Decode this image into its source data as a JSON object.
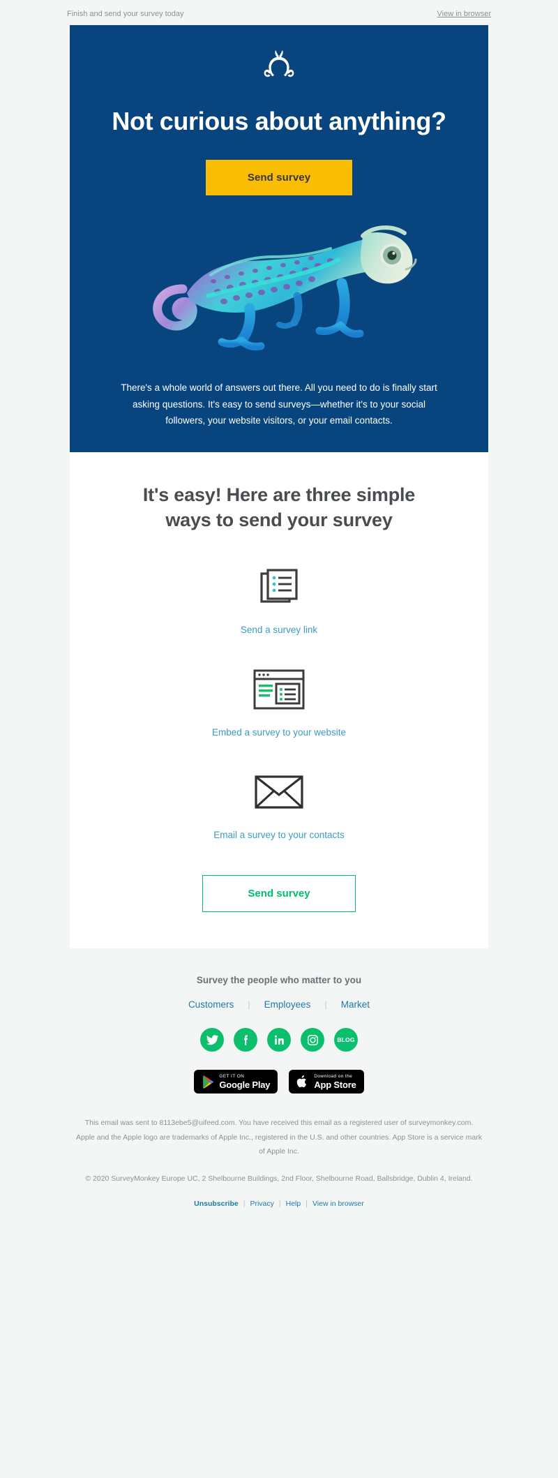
{
  "preheader": {
    "text": "Finish and send your survey today",
    "view_in_browser": "View in browser"
  },
  "hero": {
    "logo_icon": "surveymonkey-logo-icon",
    "title": "Not curious about anything?",
    "cta_label": "Send survey",
    "image_alt": "chameleon-illustration",
    "body": "There's a whole world of answers out there. All you need to do is finally start asking questions. It's easy to send surveys—whether it's to your social followers, your website visitors, or your email contacts.",
    "bg_color": "#08457e",
    "cta_bg_color": "#fbbc04",
    "cta_text_color": "#34373a"
  },
  "main": {
    "title": "It's easy! Here are three simple ways to send your survey",
    "features": [
      {
        "icon": "survey-link-icon",
        "label": "Send a survey link"
      },
      {
        "icon": "embed-website-icon",
        "label": "Embed a survey to your website"
      },
      {
        "icon": "email-envelope-icon",
        "label": "Email a survey to your contacts"
      }
    ],
    "cta_label": "Send survey",
    "cta_border_color": "#00bf6f",
    "link_color": "#3a9cc4"
  },
  "footer": {
    "heading": "Survey the people who matter to you",
    "links": [
      {
        "label": "Customers"
      },
      {
        "label": "Employees"
      },
      {
        "label": "Market"
      }
    ],
    "separator": "|",
    "social": [
      {
        "name": "twitter-icon",
        "label": ""
      },
      {
        "name": "facebook-icon",
        "label": ""
      },
      {
        "name": "linkedin-icon",
        "label": ""
      },
      {
        "name": "instagram-icon",
        "label": ""
      },
      {
        "name": "blog-icon",
        "label": "BLOG"
      }
    ],
    "social_color": "#0cbf6c",
    "stores": [
      {
        "name": "google-play-badge",
        "top": "GET IT ON",
        "bottom": "Google Play"
      },
      {
        "name": "app-store-badge",
        "top": "Download on the",
        "bottom": "App Store"
      }
    ],
    "legal_1": "This email was sent to 8113ebe5@uifeed.com. You have received this email as a registered user of surveymonkey.com.",
    "legal_2": "Apple and the Apple logo are trademarks of Apple Inc., registered in the U.S. and other countries. App Store is a service mark of Apple Inc.",
    "legal_3": "© 2020 SurveyMonkey Europe UC, 2 Shelbourne Buildings, 2nd Floor, Shelbourne Road, Ballsbridge, Dublin 4, Ireland.",
    "bottom_links": [
      {
        "label": "Unsubscribe",
        "strong": true
      },
      {
        "label": "Privacy",
        "strong": false
      },
      {
        "label": "Help",
        "strong": false
      },
      {
        "label": "View in browser",
        "strong": false
      }
    ],
    "bottom_separator": "|"
  }
}
